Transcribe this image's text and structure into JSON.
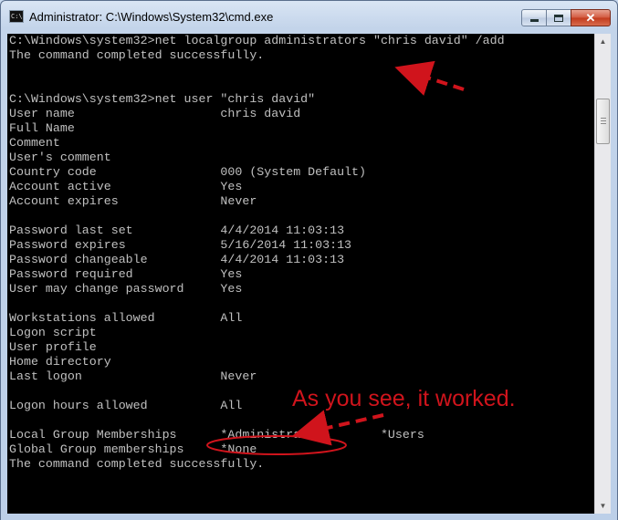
{
  "window": {
    "title": "Administrator: C:\\Windows\\System32\\cmd.exe",
    "icon": "cmd-icon",
    "icon_text": "C:\\",
    "controls": {
      "minimize": "minimize-icon",
      "maximize": "maximize-icon",
      "close": "close-icon"
    }
  },
  "console": {
    "lines": [
      "C:\\Windows\\system32>net localgroup administrators \"chris david\" /add",
      "The command completed successfully.",
      "",
      "",
      "C:\\Windows\\system32>net user \"chris david\"",
      "User name                    chris david",
      "Full Name",
      "Comment",
      "User's comment",
      "Country code                 000 (System Default)",
      "Account active               Yes",
      "Account expires              Never",
      "",
      "Password last set            4/4/2014 11:03:13",
      "Password expires             5/16/2014 11:03:13",
      "Password changeable          4/4/2014 11:03:13",
      "Password required            Yes",
      "User may change password     Yes",
      "",
      "Workstations allowed         All",
      "Logon script",
      "User profile",
      "Home directory",
      "Last logon                   Never",
      "",
      "Logon hours allowed          All",
      "",
      "Local Group Memberships      *Administrators       *Users",
      "Global Group memberships     *None",
      "The command completed successfully."
    ]
  },
  "annotation": {
    "text": "As you see, it worked.",
    "color": "#d0141c"
  },
  "colors": {
    "console_bg": "#000000",
    "console_fg": "#c0c0c0"
  }
}
